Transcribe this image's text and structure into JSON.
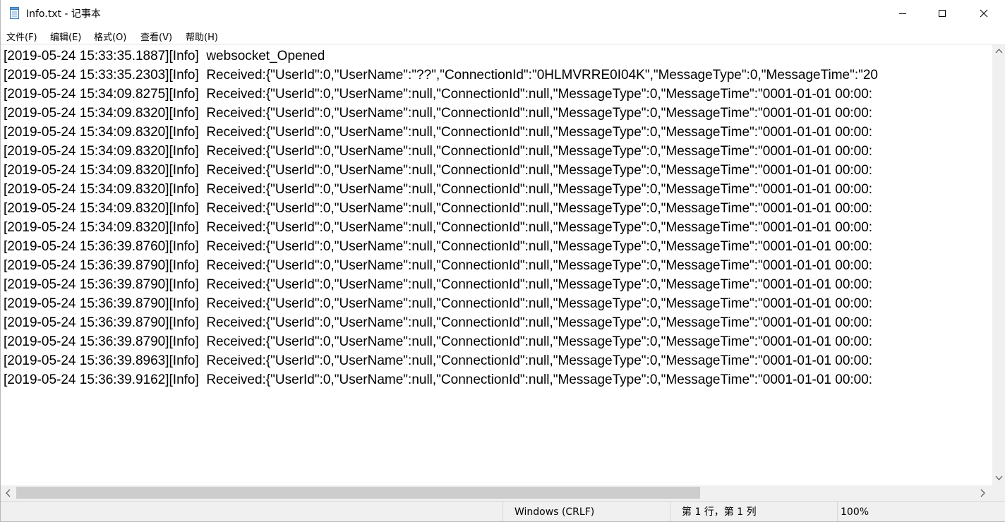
{
  "window": {
    "title": "Info.txt - 记事本"
  },
  "menu": {
    "items": [
      {
        "label": "文件(F)"
      },
      {
        "label": "编辑(E)"
      },
      {
        "label": "格式(O)"
      },
      {
        "label": "查看(V)"
      },
      {
        "label": "帮助(H)"
      }
    ]
  },
  "editor": {
    "lines": [
      "[2019-05-24 15:33:35.1887][Info]  websocket_Opened",
      "[2019-05-24 15:33:35.2303][Info]  Received:{\"UserId\":0,\"UserName\":\"??\",\"ConnectionId\":\"0HLMVRRE0I04K\",\"MessageType\":0,\"MessageTime\":\"20",
      "[2019-05-24 15:34:09.8275][Info]  Received:{\"UserId\":0,\"UserName\":null,\"ConnectionId\":null,\"MessageType\":0,\"MessageTime\":\"0001-01-01 00:00:",
      "[2019-05-24 15:34:09.8320][Info]  Received:{\"UserId\":0,\"UserName\":null,\"ConnectionId\":null,\"MessageType\":0,\"MessageTime\":\"0001-01-01 00:00:",
      "[2019-05-24 15:34:09.8320][Info]  Received:{\"UserId\":0,\"UserName\":null,\"ConnectionId\":null,\"MessageType\":0,\"MessageTime\":\"0001-01-01 00:00:",
      "[2019-05-24 15:34:09.8320][Info]  Received:{\"UserId\":0,\"UserName\":null,\"ConnectionId\":null,\"MessageType\":0,\"MessageTime\":\"0001-01-01 00:00:",
      "[2019-05-24 15:34:09.8320][Info]  Received:{\"UserId\":0,\"UserName\":null,\"ConnectionId\":null,\"MessageType\":0,\"MessageTime\":\"0001-01-01 00:00:",
      "[2019-05-24 15:34:09.8320][Info]  Received:{\"UserId\":0,\"UserName\":null,\"ConnectionId\":null,\"MessageType\":0,\"MessageTime\":\"0001-01-01 00:00:",
      "[2019-05-24 15:34:09.8320][Info]  Received:{\"UserId\":0,\"UserName\":null,\"ConnectionId\":null,\"MessageType\":0,\"MessageTime\":\"0001-01-01 00:00:",
      "[2019-05-24 15:34:09.8320][Info]  Received:{\"UserId\":0,\"UserName\":null,\"ConnectionId\":null,\"MessageType\":0,\"MessageTime\":\"0001-01-01 00:00:",
      "[2019-05-24 15:36:39.8760][Info]  Received:{\"UserId\":0,\"UserName\":null,\"ConnectionId\":null,\"MessageType\":0,\"MessageTime\":\"0001-01-01 00:00:",
      "[2019-05-24 15:36:39.8790][Info]  Received:{\"UserId\":0,\"UserName\":null,\"ConnectionId\":null,\"MessageType\":0,\"MessageTime\":\"0001-01-01 00:00:",
      "[2019-05-24 15:36:39.8790][Info]  Received:{\"UserId\":0,\"UserName\":null,\"ConnectionId\":null,\"MessageType\":0,\"MessageTime\":\"0001-01-01 00:00:",
      "[2019-05-24 15:36:39.8790][Info]  Received:{\"UserId\":0,\"UserName\":null,\"ConnectionId\":null,\"MessageType\":0,\"MessageTime\":\"0001-01-01 00:00:",
      "[2019-05-24 15:36:39.8790][Info]  Received:{\"UserId\":0,\"UserName\":null,\"ConnectionId\":null,\"MessageType\":0,\"MessageTime\":\"0001-01-01 00:00:",
      "[2019-05-24 15:36:39.8790][Info]  Received:{\"UserId\":0,\"UserName\":null,\"ConnectionId\":null,\"MessageType\":0,\"MessageTime\":\"0001-01-01 00:00:",
      "[2019-05-24 15:36:39.8963][Info]  Received:{\"UserId\":0,\"UserName\":null,\"ConnectionId\":null,\"MessageType\":0,\"MessageTime\":\"0001-01-01 00:00:",
      "[2019-05-24 15:36:39.9162][Info]  Received:{\"UserId\":0,\"UserName\":null,\"ConnectionId\":null,\"MessageType\":0,\"MessageTime\":\"0001-01-01 00:00:"
    ]
  },
  "status": {
    "encoding": "Windows (CRLF)",
    "position": "第 1 行，第 1 列",
    "zoom": "100%"
  },
  "icons": {
    "app": "notepad-icon",
    "minimize": "minimize-icon",
    "maximize": "maximize-icon",
    "close": "close-icon"
  }
}
